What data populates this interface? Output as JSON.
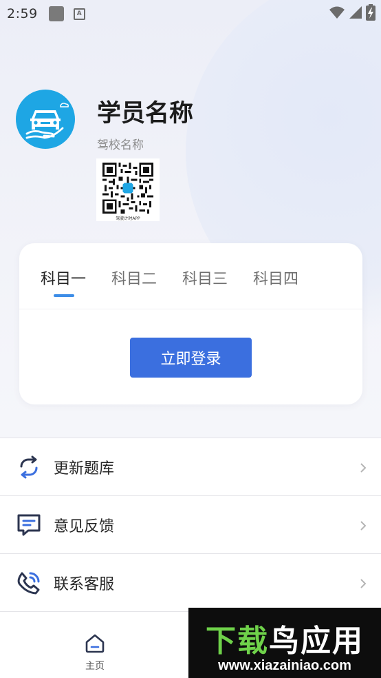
{
  "status_bar": {
    "time": "2:59",
    "notification_icon_letter": "A"
  },
  "profile": {
    "student_name": "学员名称",
    "school_name": "驾校名称",
    "qr_caption": "驾驶计时APP"
  },
  "subjects": {
    "tabs": [
      "科目一",
      "科目二",
      "科目三",
      "科目四"
    ],
    "active_index": 0,
    "login_label": "立即登录"
  },
  "menu": {
    "items": [
      {
        "label": "更新题库",
        "icon": "refresh-icon"
      },
      {
        "label": "意见反馈",
        "icon": "feedback-icon"
      },
      {
        "label": "联系客服",
        "icon": "phone-icon"
      }
    ]
  },
  "bottom_nav": {
    "home_label": "主页"
  },
  "watermark": {
    "title_part1": "下载",
    "title_part2": "鸟应用",
    "url": "www.xiazainiao.com"
  },
  "colors": {
    "accent": "#3b6fdf",
    "tab_indicator": "#3d8de7",
    "avatar_bg": "#1ea6e4"
  }
}
